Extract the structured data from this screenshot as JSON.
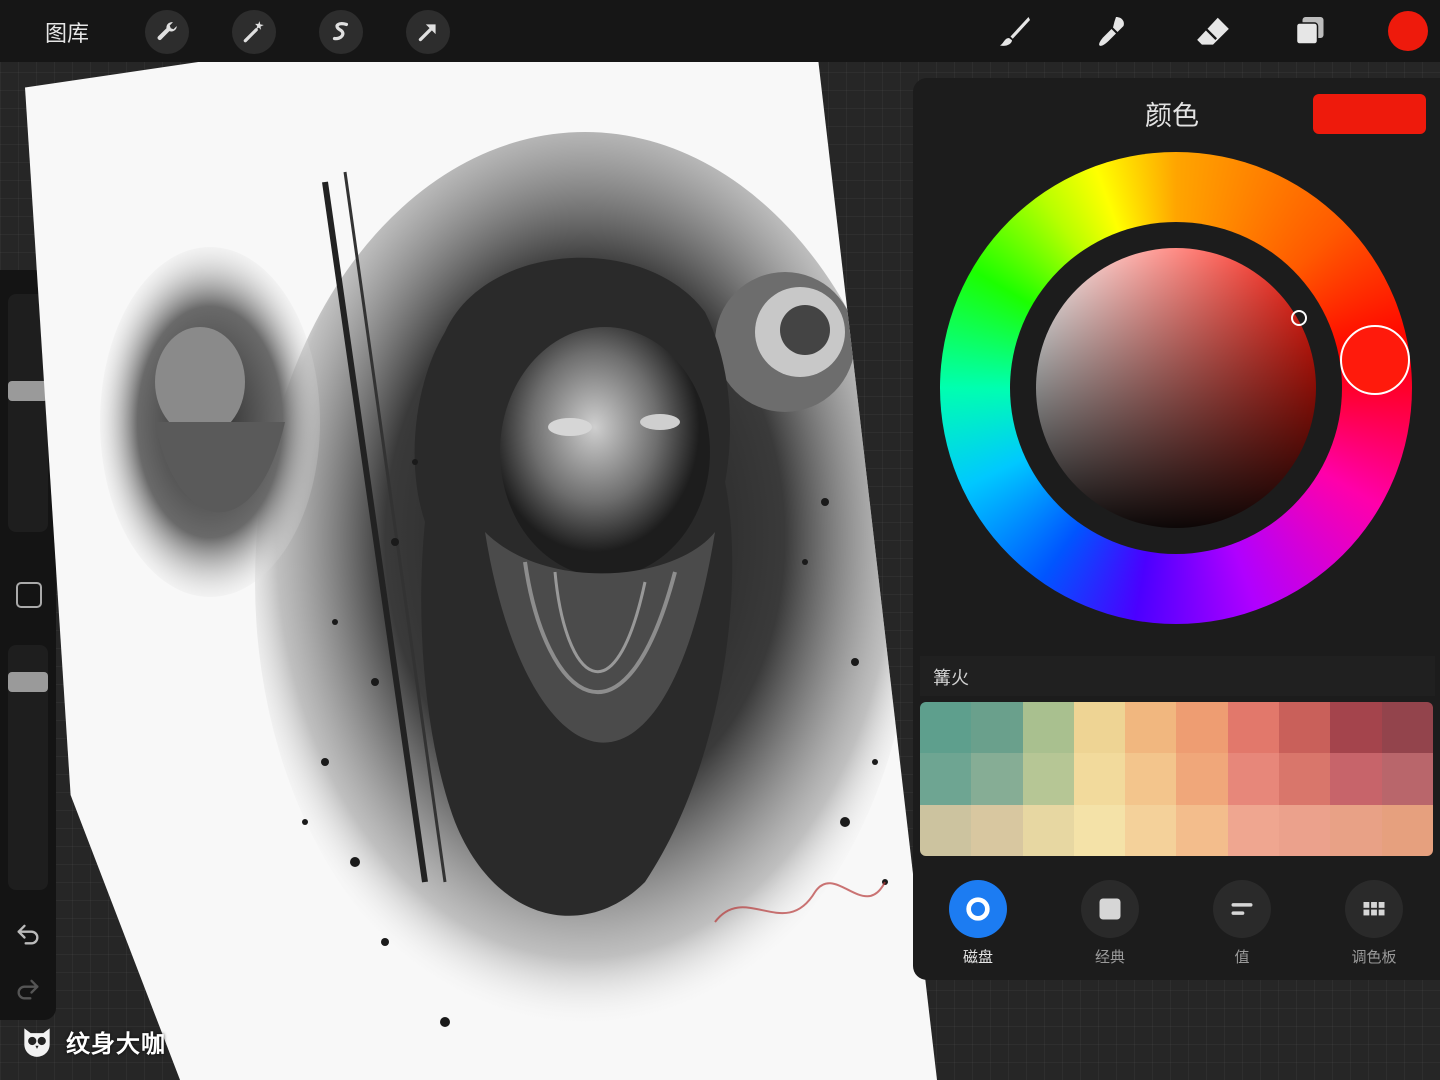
{
  "topbar": {
    "gallery_label": "图库",
    "left_tools": [
      "wrench-icon",
      "magic-wand-icon",
      "selection-icon",
      "transform-arrow-icon"
    ],
    "right_tools": [
      "brush-icon",
      "smudge-icon",
      "eraser-icon",
      "layers-icon"
    ],
    "current_color": "#ee1a0c"
  },
  "sidebar": {
    "size_slider_value": 0.6,
    "opacity_slider_value": 0.88
  },
  "color_panel": {
    "title": "颜色",
    "current_color": "#ee1a0c",
    "palette_name": "篝火",
    "palette_colors": [
      "#5e9f8d",
      "#6aa08c",
      "#a9c08f",
      "#eed494",
      "#f1b77f",
      "#ee9d72",
      "#e2786b",
      "#c9605a",
      "#a4444c",
      "#93444c",
      "#6ea592",
      "#86ad95",
      "#b6c695",
      "#f2da9c",
      "#f3c58c",
      "#f0a77a",
      "#e7877a",
      "#d9766b",
      "#c7646a",
      "#b9666b",
      "#ccc39f",
      "#d8c7a0",
      "#e7d7a2",
      "#f4e2a8",
      "#f4d19a",
      "#f3bd8c",
      "#efa690",
      "#eba18c",
      "#e8a186",
      "#e6a07e"
    ],
    "modes": [
      {
        "label": "磁盘",
        "icon": "disc-icon",
        "active": true
      },
      {
        "label": "经典",
        "icon": "square-icon",
        "active": false
      },
      {
        "label": "值",
        "icon": "sliders-icon",
        "active": false
      },
      {
        "label": "调色板",
        "icon": "grid-icon",
        "active": false
      }
    ]
  },
  "watermark": {
    "text": "纹身大咖"
  }
}
